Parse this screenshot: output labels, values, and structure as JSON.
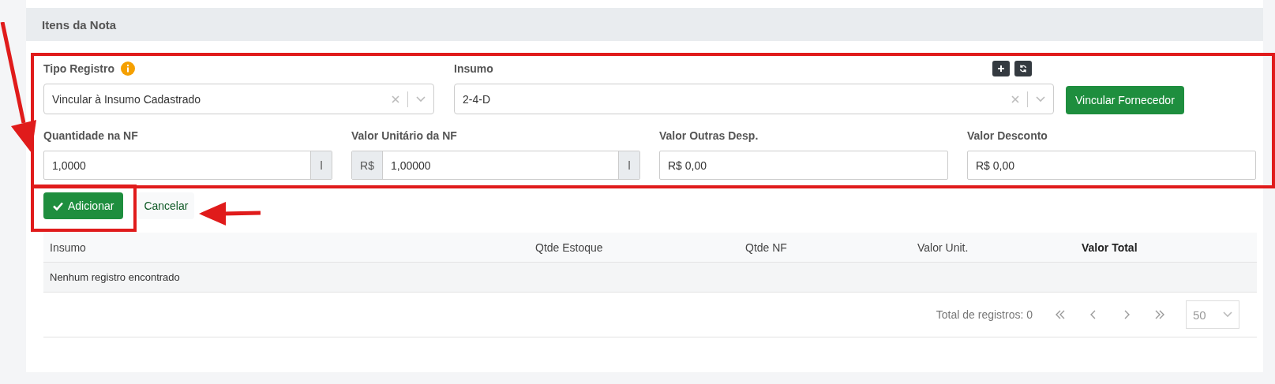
{
  "section": {
    "title": "Itens da Nota"
  },
  "form": {
    "tipo_registro": {
      "label": "Tipo Registro",
      "value": "Vincular à Insumo Cadastrado"
    },
    "insumo": {
      "label": "Insumo",
      "value": "2-4-D"
    },
    "link_button": "Vincular Fornecedor",
    "fields": [
      {
        "label": "Quantidade na NF",
        "value": "1,0000",
        "suffix": "l"
      },
      {
        "label": "Valor Unitário da NF",
        "prefix": "R$",
        "value": "1,00000",
        "suffix": "l"
      },
      {
        "label": "Valor Outras Desp.",
        "value": "R$ 0,00"
      },
      {
        "label": "Valor Desconto",
        "value": "R$ 0,00"
      }
    ]
  },
  "actions": {
    "primary": "Adicionar",
    "secondary": "Cancelar"
  },
  "table": {
    "columns": [
      {
        "label": "Insumo",
        "bold": false
      },
      {
        "label": "Qtde Estoque",
        "bold": false
      },
      {
        "label": "Qtde NF",
        "bold": false
      },
      {
        "label": "Valor Unit.",
        "bold": false
      },
      {
        "label": "Valor Total",
        "bold": true
      }
    ],
    "empty_message": "Nenhum registro encontrado"
  },
  "pagination": {
    "total": "Total de registros: 0",
    "page_size": "50"
  }
}
